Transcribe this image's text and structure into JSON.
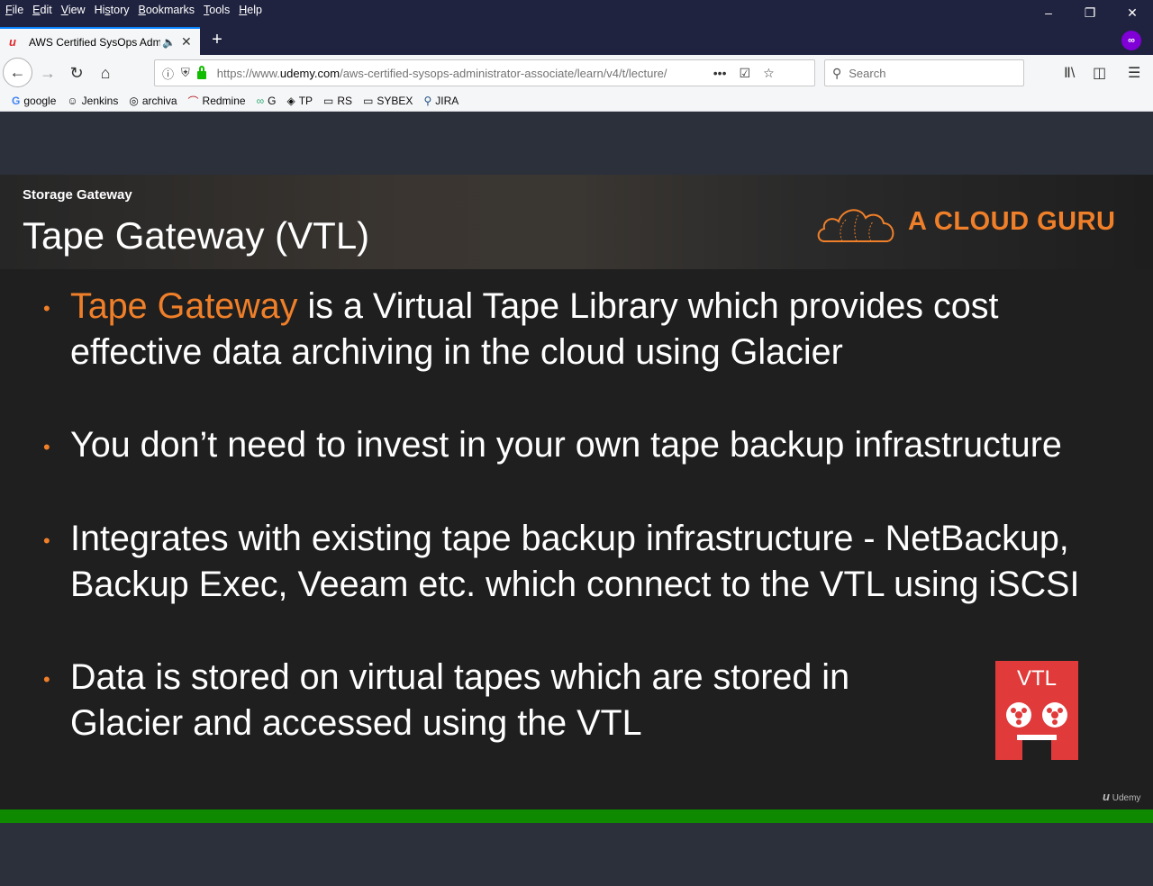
{
  "menu": [
    "File",
    "Edit",
    "View",
    "History",
    "Bookmarks",
    "Tools",
    "Help"
  ],
  "menu_underline": [
    "F",
    "E",
    "V",
    "s",
    "B",
    "T",
    "H"
  ],
  "tab": {
    "title": "AWS Certified SysOps Admi",
    "favicon": "udemy-icon"
  },
  "url": {
    "prefix": "https://www.",
    "domain": "udemy.com",
    "path": "/aws-certified-sysops-administrator-associate/learn/v4/t/lecture/"
  },
  "search": {
    "placeholder": "Search"
  },
  "bookmarks": [
    {
      "label": "google",
      "icon": "G"
    },
    {
      "label": "Jenkins",
      "icon": "☺"
    },
    {
      "label": "archiva",
      "icon": "◎"
    },
    {
      "label": "Redmine",
      "icon": "⌒"
    },
    {
      "label": "G",
      "icon": "∞"
    },
    {
      "label": "TP",
      "icon": "◈"
    },
    {
      "label": "RS",
      "icon": "▭"
    },
    {
      "label": "SYBEX",
      "icon": "▭"
    },
    {
      "label": "JIRA",
      "icon": "⚲"
    }
  ],
  "slide": {
    "subtitle": "Storage Gateway",
    "title": "Tape Gateway (VTL)",
    "brand": "A CLOUD GURU",
    "bullets": [
      {
        "highlight": "Tape Gateway",
        "text": " is a Virtual Tape Library which provides cost effective data archiving in the cloud using Glacier"
      },
      {
        "highlight": "",
        "text": "You don’t need to invest in your own tape backup infrastructure"
      },
      {
        "highlight": "",
        "text": "Integrates with existing tape backup infrastructure - NetBackup, Backup Exec, Veeam etc. which connect to the VTL using iSCSI"
      },
      {
        "highlight": "",
        "text": "Data is stored on virtual tapes which are stored in Glacier and accessed using the VTL"
      }
    ],
    "vtl_label": "VTL",
    "watermark": "Udemy"
  },
  "colors": {
    "accent": "#f07f29",
    "progress": "#0f8a00",
    "vtl": "#e03a3a"
  }
}
